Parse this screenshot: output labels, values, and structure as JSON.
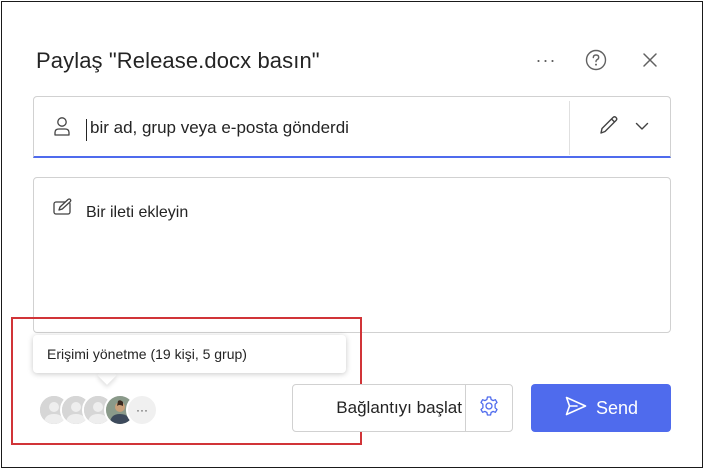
{
  "dialog": {
    "title": "Paylaş \"Release.docx basın\"",
    "more_glyph": "···"
  },
  "recipient": {
    "placeholder": "bir ad, grup veya e-posta gönderdi",
    "icon": "person-icon",
    "permission_icon": "pencil-icon"
  },
  "message": {
    "placeholder": "Bir ileti ekleyin",
    "icon": "compose-icon"
  },
  "access": {
    "tooltip": "Erişimi yönetme (19 kişi, 5 grup)",
    "more_glyph": "···"
  },
  "link": {
    "label": "Bağlantıyı başlat",
    "icon": "gear-icon"
  },
  "send": {
    "label": "Send",
    "icon": "send-icon"
  },
  "colors": {
    "accent": "#4f6bed",
    "highlight": "#d13438"
  }
}
